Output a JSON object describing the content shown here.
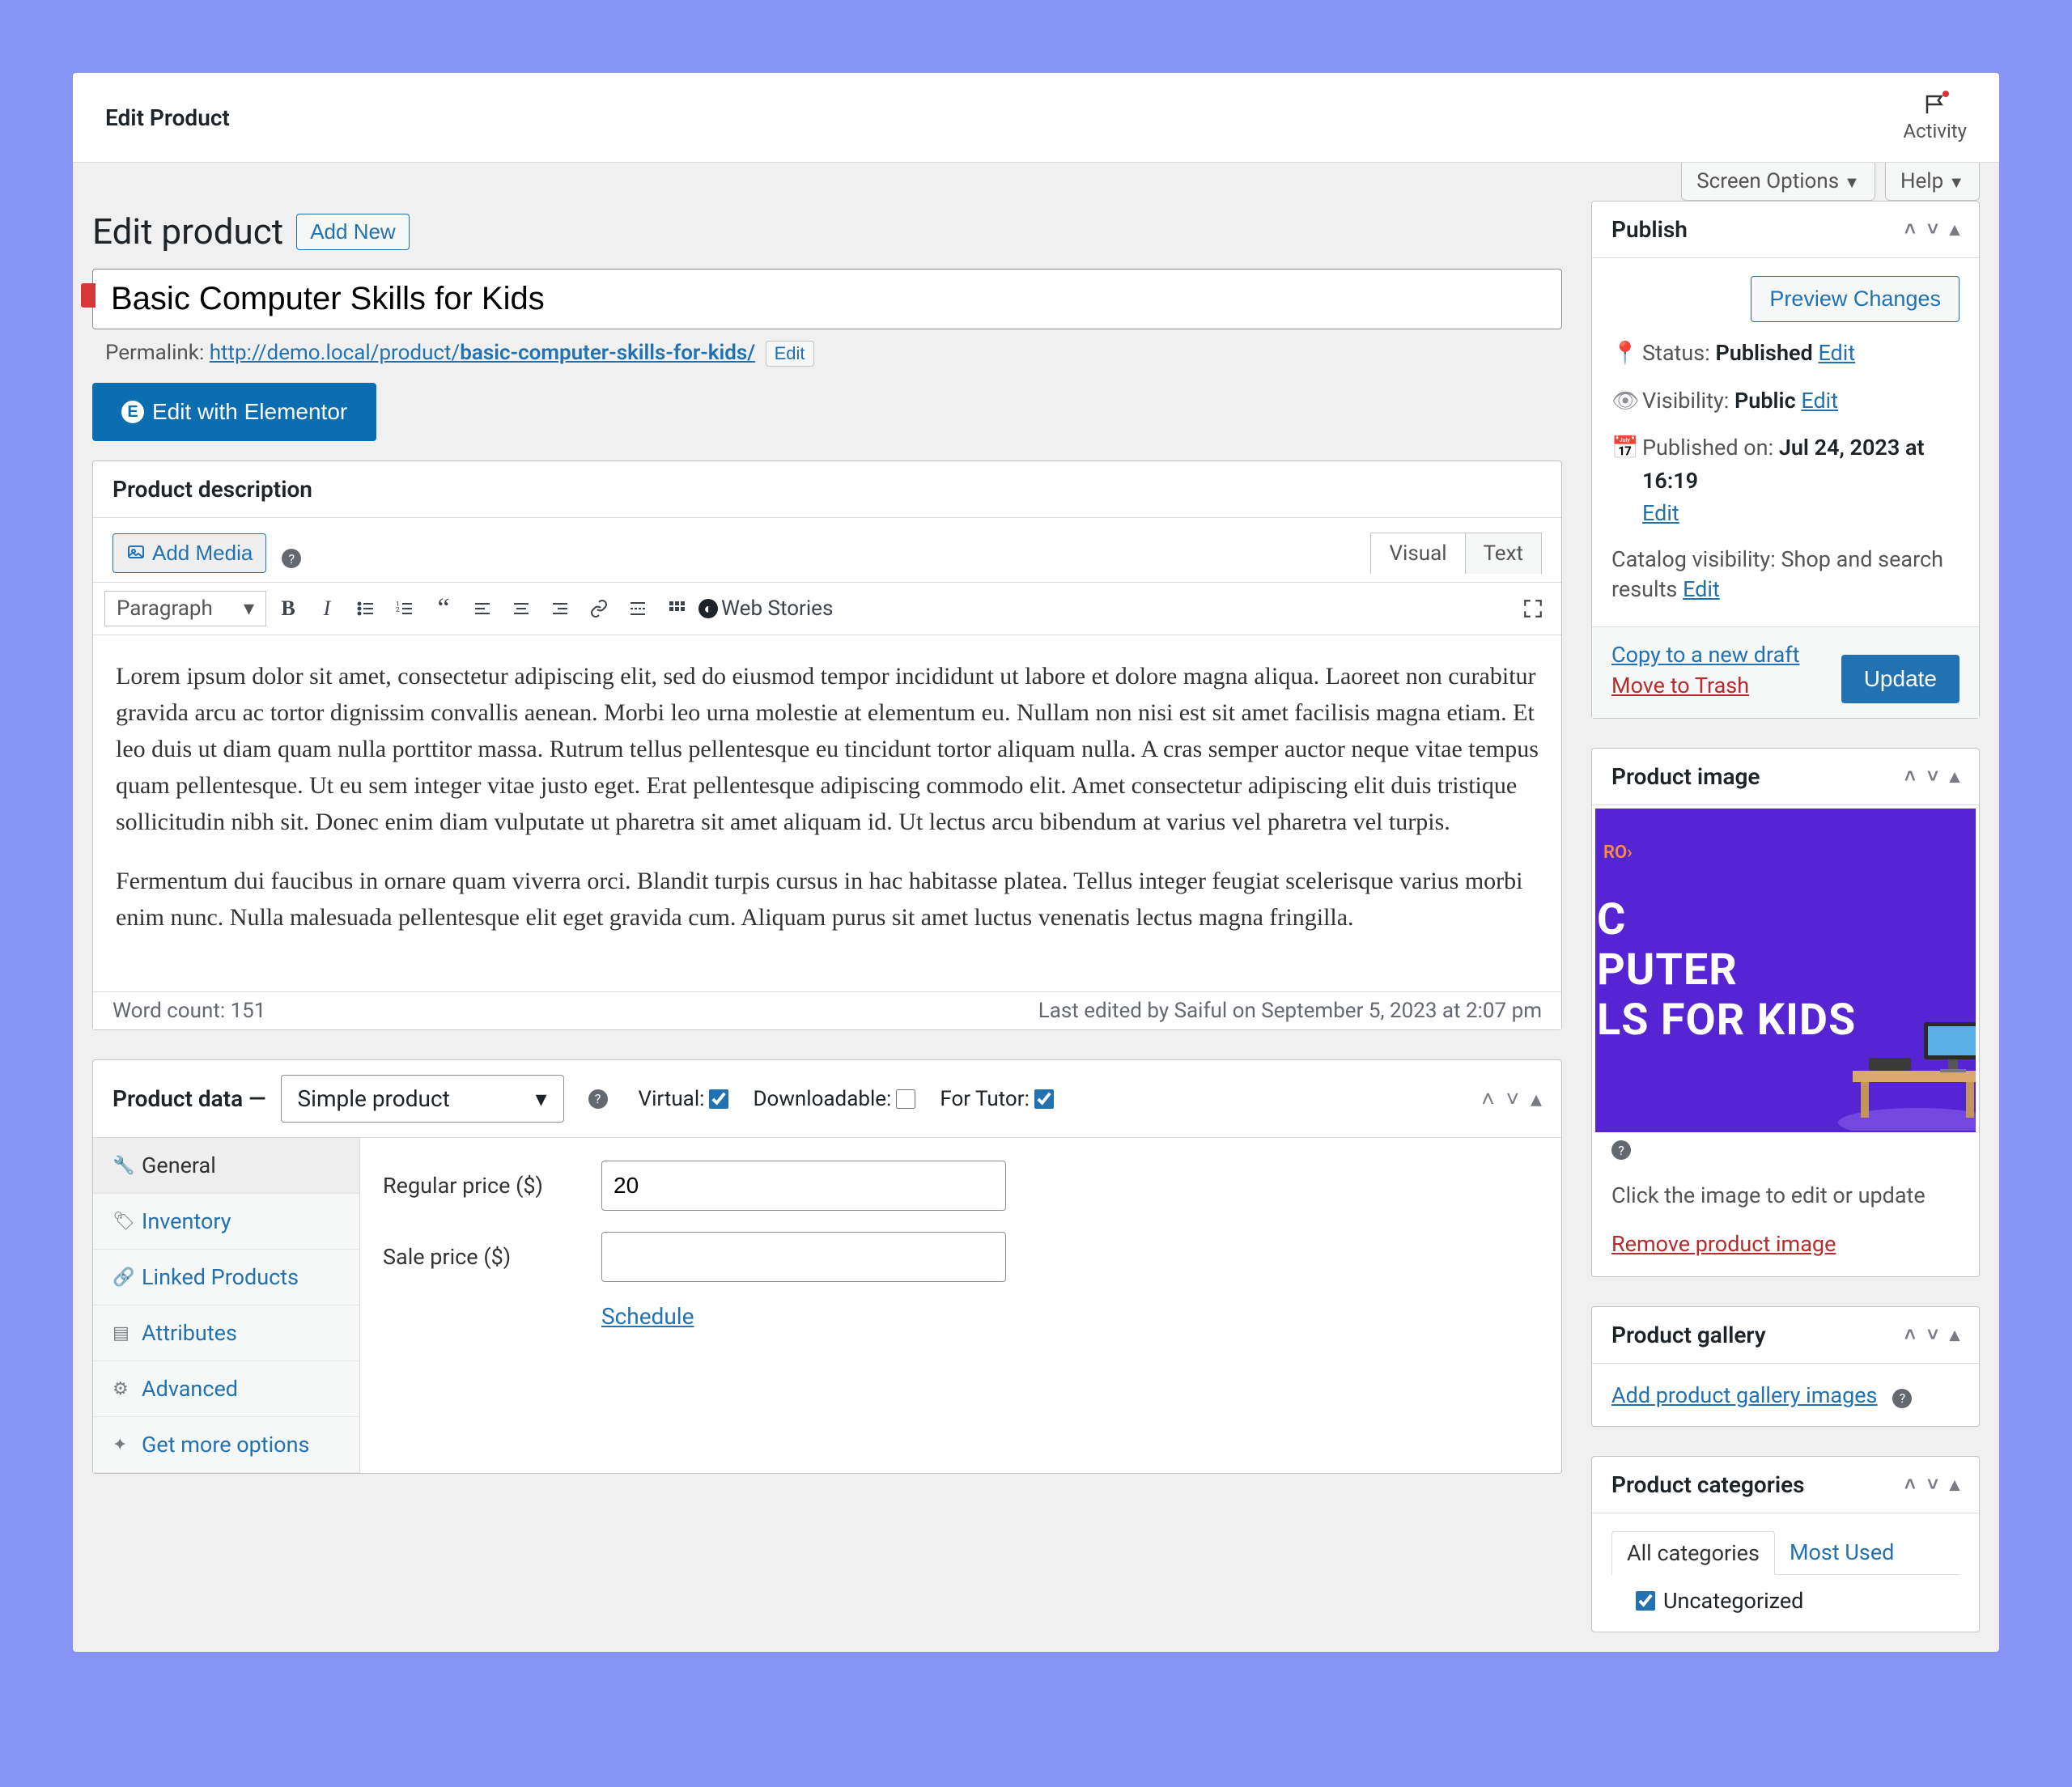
{
  "header": {
    "title": "Edit Product",
    "activity": "Activity"
  },
  "top_options": {
    "screen_options": "Screen Options",
    "help": "Help"
  },
  "page_title": "Edit product",
  "add_new": "Add New",
  "title_value": "Basic Computer Skills for Kids",
  "permalink": {
    "label": "Permalink:",
    "base": "http://demo.local/product/",
    "slug": "basic-computer-skills-for-kids/",
    "edit": "Edit"
  },
  "elementor_btn": "Edit with Elementor",
  "description": {
    "heading": "Product description",
    "add_media": "Add Media",
    "tabs": {
      "visual": "Visual",
      "text": "Text"
    },
    "paragraph": "Paragraph",
    "web_stories": "Web Stories",
    "p1": "Lorem ipsum dolor sit amet, consectetur adipiscing elit, sed do eiusmod tempor incididunt ut labore et dolore magna aliqua. Laoreet non curabitur gravida arcu ac tortor dignissim convallis aenean. Morbi leo urna molestie at elementum eu. Nullam non nisi est sit amet facilisis magna etiam. Et leo duis ut diam quam nulla porttitor massa. Rutrum tellus pellentesque eu tincidunt tortor aliquam nulla. A cras semper auctor neque vitae tempus quam pellentesque. Ut eu sem integer vitae justo eget. Erat pellentesque adipiscing commodo elit. Amet consectetur adipiscing elit duis tristique sollicitudin nibh sit. Donec enim diam vulputate ut pharetra sit amet aliquam id. Ut lectus arcu bibendum at varius vel pharetra vel turpis.",
    "p2": "Fermentum dui faucibus in ornare quam viverra orci. Blandit turpis cursus in hac habitasse platea. Tellus integer feugiat scelerisque varius morbi enim nunc. Nulla malesuada pellentesque elit eget gravida cum. Aliquam purus sit amet luctus venenatis lectus magna fringilla.",
    "word_count": "Word count: 151",
    "last_edited": "Last edited by Saiful on September 5, 2023 at 2:07 pm"
  },
  "product_data": {
    "title": "Product data —",
    "type": "Simple product",
    "virtual": "Virtual:",
    "downloadable": "Downloadable:",
    "for_tutor": "For Tutor:",
    "tabs": {
      "general": "General",
      "inventory": "Inventory",
      "linked": "Linked Products",
      "attributes": "Attributes",
      "advanced": "Advanced",
      "more": "Get more options"
    },
    "regular_price_label": "Regular price ($)",
    "regular_price_value": "20",
    "sale_price_label": "Sale price ($)",
    "sale_price_value": "",
    "schedule": "Schedule"
  },
  "publish": {
    "heading": "Publish",
    "preview": "Preview Changes",
    "status_label": "Status:",
    "status_value": "Published",
    "edit": "Edit",
    "visibility_label": "Visibility:",
    "visibility_value": "Public",
    "published_label": "Published on:",
    "published_value": "Jul 24, 2023 at 16:19",
    "catalog_label": "Catalog visibility:",
    "catalog_value": "Shop and search results",
    "copy_draft": "Copy to a new draft",
    "trash": "Move to Trash",
    "update": "Update"
  },
  "product_image": {
    "heading": "Product image",
    "text_overlay": "C\nPUTER\nLS FOR KIDS",
    "hint": "Click the image to edit or update",
    "remove": "Remove product image"
  },
  "gallery": {
    "heading": "Product gallery",
    "add": "Add product gallery images"
  },
  "categories": {
    "heading": "Product categories",
    "tab_all": "All categories",
    "tab_most": "Most Used",
    "item1": "Uncategorized"
  }
}
